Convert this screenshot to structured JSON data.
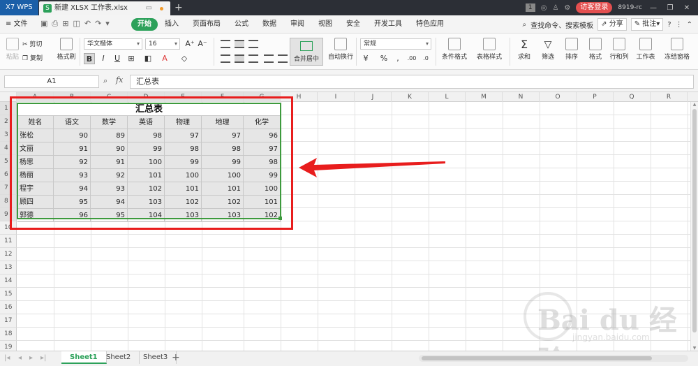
{
  "titlebar": {
    "app": "X7 WPS",
    "tab_icon": "S",
    "tab_title": "新建 XLSX 工作表.xlsx",
    "tab_badge": "1",
    "login": "访客登录",
    "user": "8919-rc"
  },
  "menubar": {
    "file": "≡ 文件",
    "menus": [
      "开始",
      "插入",
      "页面布局",
      "公式",
      "数据",
      "审阅",
      "视图",
      "安全",
      "开发工具",
      "特色应用"
    ],
    "search": "查找命令、搜索模板",
    "share": "分享",
    "comment": "批注"
  },
  "ribbon": {
    "paste": "粘贴",
    "cut": "剪切",
    "copy": "复制",
    "format_painter": "格式刷",
    "font_name": "华文楷体",
    "font_size": "16",
    "merge": "合并居中",
    "wrap": "自动换行",
    "number_format": "常规",
    "cond_format": "条件格式",
    "table_style": "表格样式",
    "sum": "求和",
    "filter": "筛选",
    "sort": "排序",
    "format": "格式",
    "rowcol": "行和列",
    "sheet": "工作表",
    "freeze": "冻结窗格"
  },
  "formula_bar": {
    "name_box": "A1",
    "fx": "fx",
    "content": "汇总表"
  },
  "grid": {
    "columns": [
      "A",
      "B",
      "C",
      "D",
      "E",
      "F",
      "G",
      "H",
      "I",
      "J",
      "K",
      "L",
      "M",
      "N",
      "O",
      "P",
      "Q",
      "R"
    ],
    "rows": [
      "1",
      "2",
      "3",
      "4",
      "5",
      "6",
      "7",
      "8",
      "9",
      "10",
      "11",
      "12",
      "13",
      "14",
      "15",
      "16",
      "17",
      "18",
      "19"
    ]
  },
  "table": {
    "title": "汇总表",
    "headers": [
      "姓名",
      "语文",
      "数学",
      "英语",
      "物理",
      "地理",
      "化学"
    ],
    "rows": [
      [
        "张松",
        "90",
        "89",
        "98",
        "97",
        "97",
        "96"
      ],
      [
        "文丽",
        "91",
        "90",
        "99",
        "98",
        "98",
        "97"
      ],
      [
        "杨思",
        "92",
        "91",
        "100",
        "99",
        "99",
        "98"
      ],
      [
        "杨丽",
        "93",
        "92",
        "101",
        "100",
        "100",
        "99"
      ],
      [
        "程宇",
        "94",
        "93",
        "102",
        "101",
        "101",
        "100"
      ],
      [
        "顾四",
        "95",
        "94",
        "103",
        "102",
        "102",
        "101"
      ],
      [
        "郭德",
        "96",
        "95",
        "104",
        "103",
        "103",
        "102"
      ]
    ]
  },
  "sheets": [
    "Sheet1",
    "Sheet2",
    "Sheet3"
  ],
  "watermark": {
    "main": "Bai du 经验",
    "sub": "jingyan.baidu.com"
  },
  "colors": {
    "accent": "#2ca15a",
    "highlight_red": "#e81d1d",
    "selection_green": "#3d9a3d"
  }
}
